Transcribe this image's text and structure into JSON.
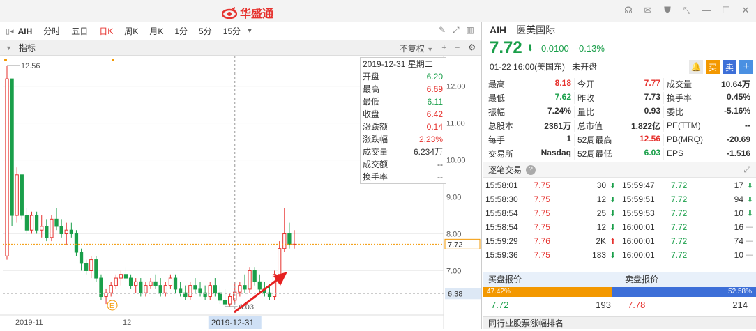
{
  "app": {
    "title": "华盛通"
  },
  "toolbar": {
    "symbol": "AIH",
    "periods": [
      "分时",
      "五日",
      "日K",
      "周K",
      "月K",
      "1分",
      "5分",
      "15分"
    ],
    "active": "日K"
  },
  "indicator": {
    "label": "指标",
    "adjust": "不复权"
  },
  "info_box": {
    "date": "2019-12-31 星期二",
    "rows": [
      {
        "label": "开盘",
        "value": "6.20",
        "color": "dn"
      },
      {
        "label": "最高",
        "value": "6.69",
        "color": "up"
      },
      {
        "label": "最低",
        "value": "6.11",
        "color": "dn"
      },
      {
        "label": "收盘",
        "value": "6.42",
        "color": "up"
      },
      {
        "label": "涨跌额",
        "value": "0.14",
        "color": "up"
      },
      {
        "label": "涨跌幅",
        "value": "2.23%",
        "color": "up"
      },
      {
        "label": "成交量",
        "value": "6.234万",
        "color": ""
      },
      {
        "label": "成交额",
        "value": "--",
        "color": ""
      },
      {
        "label": "换手率",
        "value": "--",
        "color": ""
      }
    ]
  },
  "chart_data": {
    "type": "candlestick",
    "y_ticks": [
      "12.00",
      "11.00",
      "10.00",
      "9.00",
      "8.00",
      "7.00"
    ],
    "x_labels": [
      "2019-11",
      "12",
      "2019-12-31"
    ],
    "high_label": "12.56",
    "low_label": "6.03",
    "last_price": "7.72",
    "ref_price": "6.38",
    "marker": "E",
    "ohlc": [
      [
        7.4,
        12.56,
        7.3,
        12.2
      ],
      [
        12.2,
        12.2,
        8.2,
        8.5
      ],
      [
        8.5,
        9.8,
        8.3,
        9.6
      ],
      [
        9.6,
        9.6,
        8.4,
        8.5
      ],
      [
        8.5,
        8.7,
        8.0,
        8.1
      ],
      [
        8.1,
        8.6,
        8.0,
        8.5
      ],
      [
        8.5,
        8.6,
        8.0,
        8.1
      ],
      [
        8.1,
        8.5,
        7.9,
        8.2
      ],
      [
        8.2,
        8.4,
        7.8,
        7.9
      ],
      [
        7.9,
        8.5,
        7.8,
        8.4
      ],
      [
        8.4,
        8.7,
        8.1,
        8.2
      ],
      [
        8.2,
        8.4,
        7.9,
        8.0
      ],
      [
        8.0,
        8.3,
        7.7,
        8.1
      ],
      [
        8.1,
        8.3,
        7.9,
        8.0
      ],
      [
        8.0,
        8.1,
        7.4,
        7.5
      ],
      [
        7.5,
        7.6,
        7.0,
        7.2
      ],
      [
        7.2,
        7.3,
        6.9,
        7.0
      ],
      [
        7.0,
        7.4,
        6.8,
        7.3
      ],
      [
        7.3,
        7.4,
        6.7,
        6.8
      ],
      [
        6.8,
        6.9,
        6.2,
        6.3
      ],
      [
        6.3,
        6.5,
        6.1,
        6.4
      ],
      [
        6.4,
        6.7,
        6.3,
        6.6
      ],
      [
        6.6,
        6.9,
        6.5,
        6.8
      ],
      [
        6.8,
        7.0,
        6.6,
        6.9
      ],
      [
        6.9,
        7.1,
        6.7,
        6.8
      ],
      [
        6.8,
        6.9,
        6.5,
        6.6
      ],
      [
        6.6,
        6.8,
        6.4,
        6.7
      ],
      [
        6.7,
        6.8,
        6.3,
        6.4
      ],
      [
        6.4,
        6.7,
        6.3,
        6.6
      ],
      [
        6.6,
        6.8,
        6.5,
        6.7
      ],
      [
        6.7,
        6.9,
        6.5,
        6.6
      ],
      [
        6.6,
        6.8,
        6.3,
        6.4
      ],
      [
        6.4,
        6.7,
        6.3,
        6.6
      ],
      [
        6.6,
        6.9,
        6.5,
        6.8
      ],
      [
        6.8,
        6.9,
        6.4,
        6.5
      ],
      [
        6.5,
        6.7,
        6.3,
        6.4
      ],
      [
        6.4,
        6.6,
        6.2,
        6.3
      ],
      [
        6.3,
        6.7,
        6.2,
        6.6
      ],
      [
        6.6,
        6.8,
        6.4,
        6.5
      ],
      [
        6.5,
        6.7,
        6.3,
        6.4
      ],
      [
        6.4,
        6.6,
        6.2,
        6.3
      ],
      [
        6.3,
        6.7,
        6.2,
        6.6
      ],
      [
        6.6,
        6.8,
        6.3,
        6.4
      ],
      [
        6.4,
        6.6,
        6.1,
        6.2
      ],
      [
        6.2,
        6.5,
        6.03,
        6.1
      ],
      [
        6.1,
        6.4,
        6.03,
        6.3
      ],
      [
        6.2,
        6.69,
        6.11,
        6.42
      ],
      [
        6.42,
        6.7,
        6.3,
        6.6
      ],
      [
        6.6,
        6.9,
        6.4,
        6.5
      ],
      [
        6.5,
        7.1,
        6.4,
        7.0
      ],
      [
        7.0,
        7.1,
        6.6,
        6.7
      ],
      [
        6.7,
        6.9,
        6.4,
        6.5
      ],
      [
        6.5,
        6.7,
        6.3,
        6.4
      ],
      [
        6.4,
        6.6,
        6.2,
        6.3
      ],
      [
        6.3,
        7.0,
        6.2,
        6.9
      ],
      [
        6.9,
        7.8,
        6.8,
        7.6
      ],
      [
        7.6,
        8.7,
        7.5,
        8.0
      ],
      [
        8.0,
        8.3,
        7.6,
        7.7
      ],
      [
        7.7,
        8.1,
        7.6,
        7.72
      ]
    ]
  },
  "quote": {
    "symbol": "AIH",
    "name": "医美国际",
    "price": "7.72",
    "change": "-0.0100",
    "change_pct": "-0.13%",
    "time": "01-22 16:00(美国东)",
    "status": "未开盘",
    "buy_label": "买",
    "sell_label": "卖",
    "add_label": "+"
  },
  "stats": [
    [
      {
        "l": "最高",
        "v": "8.18",
        "c": "up"
      },
      {
        "l": "今开",
        "v": "7.77",
        "c": "up"
      },
      {
        "l": "成交量",
        "v": "10.64万",
        "c": ""
      }
    ],
    [
      {
        "l": "最低",
        "v": "7.62",
        "c": "dn"
      },
      {
        "l": "昨收",
        "v": "7.73",
        "c": ""
      },
      {
        "l": "换手率",
        "v": "0.45%",
        "c": ""
      }
    ],
    [
      {
        "l": "振幅",
        "v": "7.24%",
        "c": ""
      },
      {
        "l": "量比",
        "v": "0.93",
        "c": ""
      },
      {
        "l": "委比",
        "v": "-5.16%",
        "c": ""
      }
    ],
    [
      {
        "l": "总股本",
        "v": "2361万",
        "c": ""
      },
      {
        "l": "总市值",
        "v": "1.822亿",
        "c": ""
      },
      {
        "l": "PE(TTM)",
        "v": "--",
        "c": ""
      }
    ],
    [
      {
        "l": "每手",
        "v": "1",
        "c": ""
      },
      {
        "l": "52周最高",
        "v": "12.56",
        "c": "up"
      },
      {
        "l": "PB(MRQ)",
        "v": "-20.69",
        "c": ""
      }
    ],
    [
      {
        "l": "交易所",
        "v": "Nasdaq",
        "c": ""
      },
      {
        "l": "52周最低",
        "v": "6.03",
        "c": "dn"
      },
      {
        "l": "EPS",
        "v": "-1.516",
        "c": ""
      }
    ]
  ],
  "ticks_title": "逐笔交易",
  "ticks_left": [
    {
      "t": "15:58:01",
      "p": "7.75",
      "v": "30",
      "d": "down"
    },
    {
      "t": "15:58:30",
      "p": "7.75",
      "v": "12",
      "d": "down"
    },
    {
      "t": "15:58:54",
      "p": "7.75",
      "v": "25",
      "d": "down"
    },
    {
      "t": "15:58:54",
      "p": "7.75",
      "v": "12",
      "d": "down"
    },
    {
      "t": "15:59:29",
      "p": "7.76",
      "v": "2K",
      "d": "up"
    },
    {
      "t": "15:59:36",
      "p": "7.75",
      "v": "183",
      "d": "down"
    }
  ],
  "ticks_right": [
    {
      "t": "15:59:47",
      "p": "7.72",
      "v": "17",
      "d": "down"
    },
    {
      "t": "15:59:51",
      "p": "7.72",
      "v": "94",
      "d": "down"
    },
    {
      "t": "15:59:53",
      "p": "7.72",
      "v": "10",
      "d": "down"
    },
    {
      "t": "16:00:01",
      "p": "7.72",
      "v": "16",
      "d": "flat"
    },
    {
      "t": "16:00:01",
      "p": "7.72",
      "v": "74",
      "d": "flat"
    },
    {
      "t": "16:00:01",
      "p": "7.72",
      "v": "10",
      "d": "flat"
    }
  ],
  "orderbook": {
    "buy_title": "买盘报价",
    "sell_title": "卖盘报价",
    "buy_pct": "47.42%",
    "sell_pct": "52.58%",
    "buy_price": "7.72",
    "buy_vol": "193",
    "sell_price": "7.78",
    "sell_vol": "214"
  },
  "footer": "同行业股票涨幅排名",
  "colors": {
    "up": "#e6322e",
    "down": "#1a9f4a",
    "orange": "#f39800",
    "blue": "#3d6fd8"
  }
}
